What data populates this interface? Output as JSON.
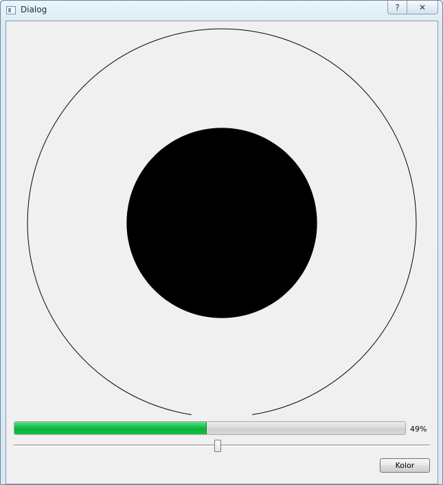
{
  "window": {
    "title": "Dialog",
    "help_button_glyph": "?",
    "close_button_glyph": "✕"
  },
  "drawing": {
    "outer_ring_color": "#000000",
    "inner_disc_color": "#000000",
    "outer_ring_gap_fraction": 0.05,
    "inner_to_outer_ratio": 0.49
  },
  "progress": {
    "value": 49,
    "text": "49%",
    "fill_color": "#06b23a"
  },
  "slider": {
    "value_fraction": 0.49
  },
  "buttons": {
    "kolor_label": "Kolor"
  }
}
